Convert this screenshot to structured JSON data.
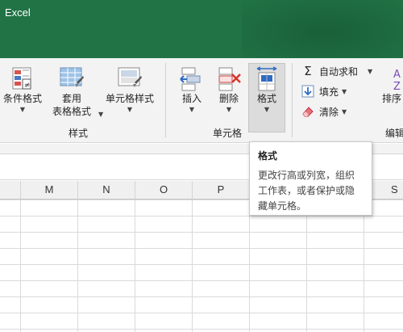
{
  "app": {
    "title": "Excel"
  },
  "ribbon": {
    "styles_group": {
      "label": "样式",
      "conditional_format": "条件格式",
      "table_format_line1": "套用",
      "table_format_line2": "表格格式",
      "cell_styles": "单元格样式"
    },
    "cells_group": {
      "label": "单元格",
      "insert": "插入",
      "delete": "删除",
      "format": "格式"
    },
    "editing_group": {
      "label": "编辑",
      "autosum": "自动求和",
      "fill": "填充",
      "clear": "清除",
      "sort": "排序"
    }
  },
  "columns": [
    "M",
    "N",
    "O",
    "P",
    "S"
  ],
  "tooltip": {
    "title": "格式",
    "body": "更改行高或列宽，组织工作表，或者保护或隐藏单元格。"
  },
  "colors": {
    "accent": "#217346",
    "ribbon": "#f3f3f3"
  }
}
